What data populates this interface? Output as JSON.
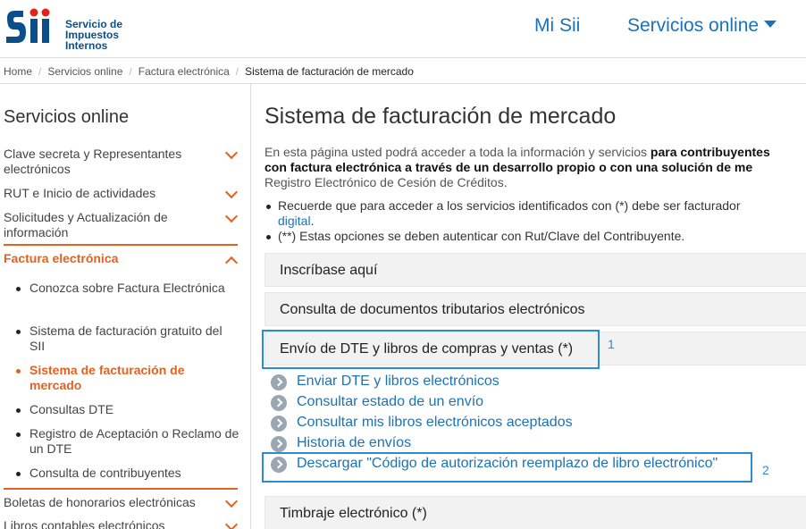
{
  "header": {
    "logo": {
      "mark": "SII",
      "line1": "Servicio de",
      "line2": "Impuestos",
      "line3": "Internos"
    },
    "nav_misii": "Mi Sii",
    "nav_servicios": "Servicios online",
    "brand_color": "#0b4f8a",
    "link_color": "#1a73b8",
    "accent_color": "#e5611f"
  },
  "breadcrumb": {
    "items": [
      "Home",
      "Servicios online",
      "Factura electrónica"
    ],
    "current": "Sistema de facturación de mercado"
  },
  "sidebar": {
    "title": "Servicios online",
    "items": [
      {
        "label": "Clave secreta y Representantes electrónicos"
      },
      {
        "label": "RUT e Inicio de actividades"
      },
      {
        "label": "Solicitudes y Actualización de información"
      },
      {
        "label": "Factura electrónica"
      },
      {
        "label": "Boletas de honorarios electrónicas"
      },
      {
        "label": "Libros contables electrónicos"
      }
    ],
    "subitems": [
      {
        "label": "Conozca sobre Factura Electrónica"
      },
      {
        "label": "Sistema de facturación gratuito del SII"
      },
      {
        "label": "Sistema de facturación de mercado"
      },
      {
        "label": "Consultas DTE"
      },
      {
        "label": "Registro de Aceptación o Reclamo de un DTE"
      },
      {
        "label": "Consulta de contribuyentes"
      }
    ]
  },
  "main": {
    "title": "Sistema de facturación de mercado",
    "intro_normal1": "En esta página usted podrá acceder a toda la información y servicios ",
    "intro_bold1": "para contribuyentes",
    "intro_bold2": "con factura electrónica a través de un desarrollo propio o con una solución de me",
    "intro_line3": "Registro Electrónico de Cesión de Créditos.",
    "bullet1_text": "Recuerde que para acceder a los servicios identificados con (*) debe ser facturador",
    "bullet1_link": "digital",
    "bullet1_end": ".",
    "bullet2_text": "(**) Estas opciones se deben autenticar con Rut/Clave del Contribuyente.",
    "accordions": [
      {
        "label": "Inscríbase aquí"
      },
      {
        "label": "Consulta de documentos tributarios electrónicos"
      },
      {
        "label": "Envío de DTE y libros de compras y ventas (*)"
      },
      {
        "label": "Timbraje electrónico (*)"
      }
    ],
    "links": [
      {
        "label": "Enviar DTE y libros electrónicos"
      },
      {
        "label": "Consultar estado de un envío"
      },
      {
        "label": "Consultar mis libros electrónicos aceptados"
      },
      {
        "label": "Historia de envíos"
      },
      {
        "label": "Descargar \"Código de autorización reemplazo de libro electrónico\""
      }
    ]
  },
  "annotations": [
    {
      "number": "1"
    },
    {
      "number": "2"
    }
  ]
}
